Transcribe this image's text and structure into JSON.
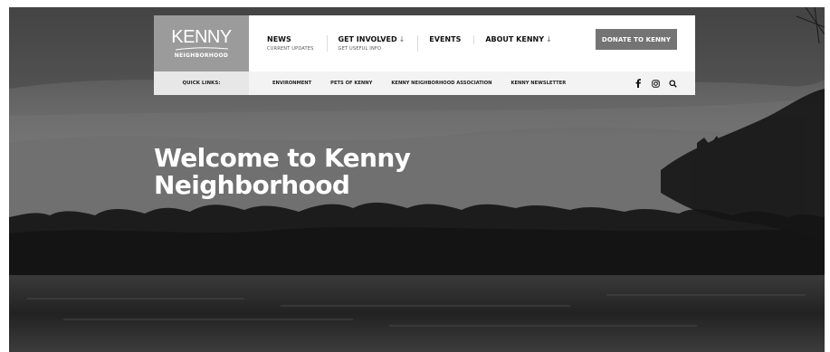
{
  "logo": {
    "main": "KENNY",
    "sub": "NEIGHBORHOOD"
  },
  "nav": [
    {
      "label": "NEWS",
      "sub": "CURRENT UPDATES",
      "arrow": ""
    },
    {
      "label": "GET INVOLVED",
      "sub": "GET USEFUL INFO",
      "arrow": "↓"
    },
    {
      "label": "EVENTS",
      "sub": "",
      "arrow": ""
    },
    {
      "label": "ABOUT KENNY",
      "sub": "",
      "arrow": "↓"
    }
  ],
  "donate_label": "DONATE TO KENNY",
  "quick_links": {
    "title": "QUICK LINKS:",
    "items": [
      "ENVIRONMENT",
      "PETS OF KENNY",
      "KENNY NEIGHBORHOOD ASSOCIATION",
      "KENNY NEWSLETTER"
    ]
  },
  "social_icons": [
    "facebook-icon",
    "instagram-icon",
    "search-icon"
  ],
  "hero": {
    "title_line1": "Welcome to Kenny",
    "title_line2": "Neighborhood"
  },
  "colors": {
    "logo_bg": "#9b9b9b",
    "donate_bg": "#747474",
    "quickbar_bg": "#f3f3f3",
    "quick_title_bg": "#e7e7e7"
  }
}
